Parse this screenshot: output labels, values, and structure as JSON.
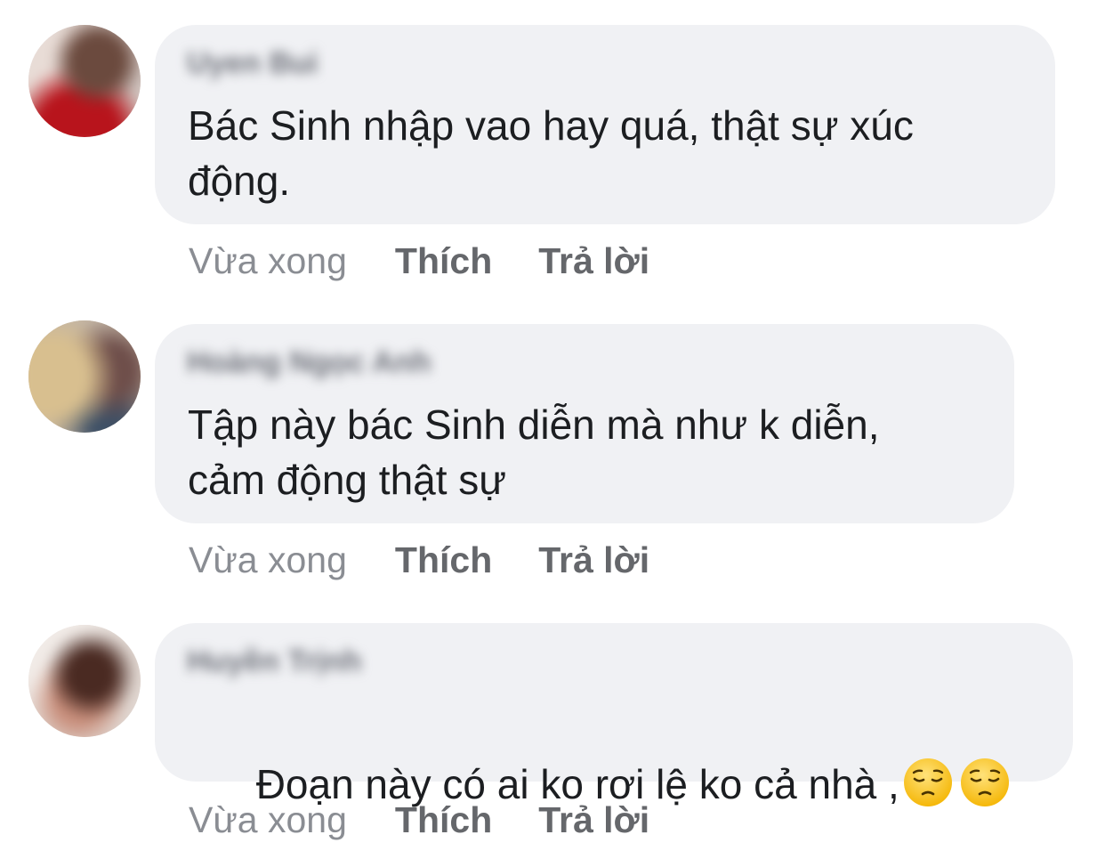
{
  "comments": [
    {
      "author": "Uyen Bui",
      "text": "Bác Sinh nhập vao hay quá, thật sự xúc\nđộng.",
      "time": "Vừa xong",
      "like_label": "Thích",
      "reply_label": "Trả lời"
    },
    {
      "author": "Hoàng Ngọc Anh",
      "text": "Tập này bác Sinh diễn mà như k diễn,\ncảm động thật sự",
      "time": "Vừa xong",
      "like_label": "Thích",
      "reply_label": "Trả lời"
    },
    {
      "author": "Huyền Trịnh",
      "text": "Đoạn này có ai ko rơi lệ ko cả nhà ,",
      "emojis": [
        "pensive-face-emoji",
        "pensive-face-emoji"
      ],
      "time": "Vừa xong",
      "like_label": "Thích",
      "reply_label": "Trả lời"
    }
  ],
  "colors": {
    "bubble": "#f0f1f4",
    "text": "#1c1e21",
    "action": "#65676b",
    "timestamp": "#8a8d93"
  }
}
